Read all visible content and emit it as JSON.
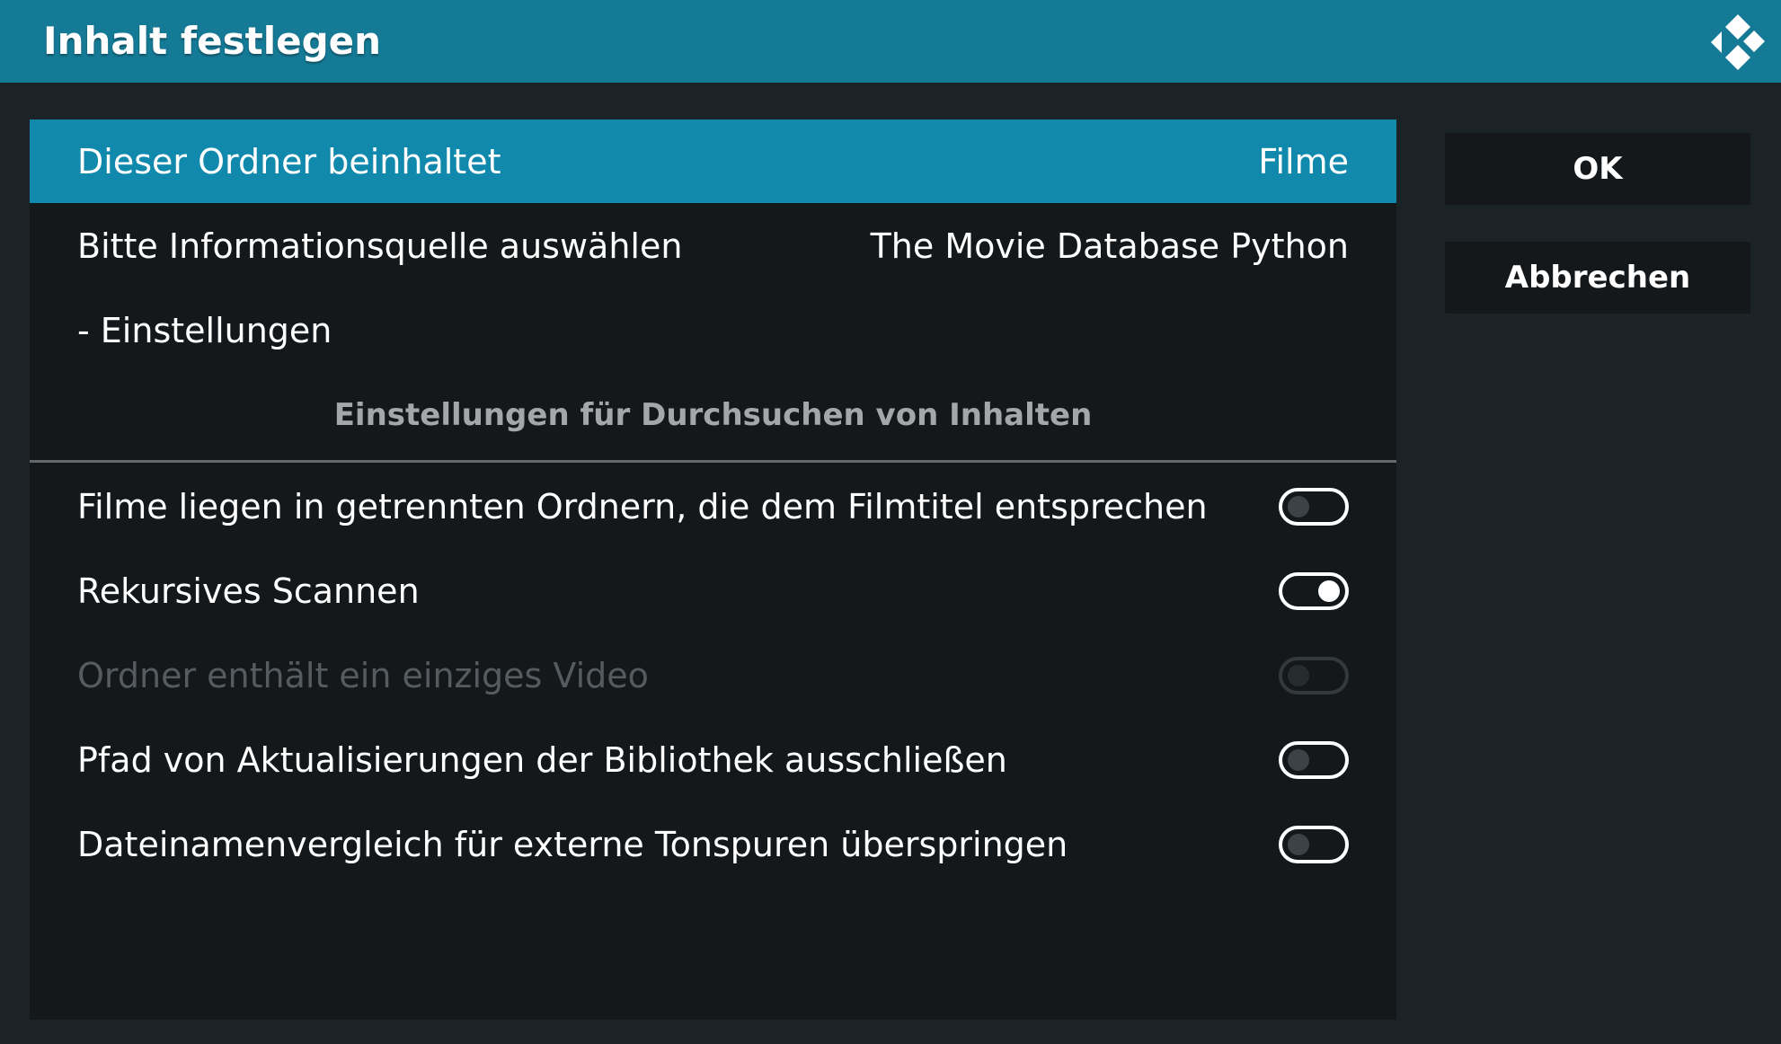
{
  "dialog": {
    "title": "Inhalt festlegen"
  },
  "settings": {
    "content_type": {
      "label": "Dieser Ordner beinhaltet",
      "value": "Filme"
    },
    "info_source": {
      "label": "Bitte Informationsquelle auswählen",
      "value": "The Movie Database Python"
    },
    "scraper_settings": {
      "label": "- Einstellungen"
    },
    "section_header": "Einstellungen für Durchsuchen von Inhalten",
    "options": [
      {
        "label": "Filme liegen in getrennten Ordnern, die dem Filmtitel entsprechen",
        "enabled": false,
        "disabled": false
      },
      {
        "label": "Rekursives Scannen",
        "enabled": true,
        "disabled": false
      },
      {
        "label": "Ordner enthält ein einziges Video",
        "enabled": false,
        "disabled": true
      },
      {
        "label": "Pfad von Aktualisierungen der Bibliothek ausschließen",
        "enabled": false,
        "disabled": false
      },
      {
        "label": "Dateinamenvergleich für externe Tonspuren überspringen",
        "enabled": false,
        "disabled": false
      }
    ]
  },
  "buttons": {
    "ok_label": "OK",
    "cancel_label": "Abbrechen"
  },
  "icons": {
    "logo": "kodi-logo-icon"
  },
  "colors": {
    "titlebar": "#157a96",
    "selected": "#1089ac",
    "panel": "#14181b",
    "background": "#1b2326"
  }
}
